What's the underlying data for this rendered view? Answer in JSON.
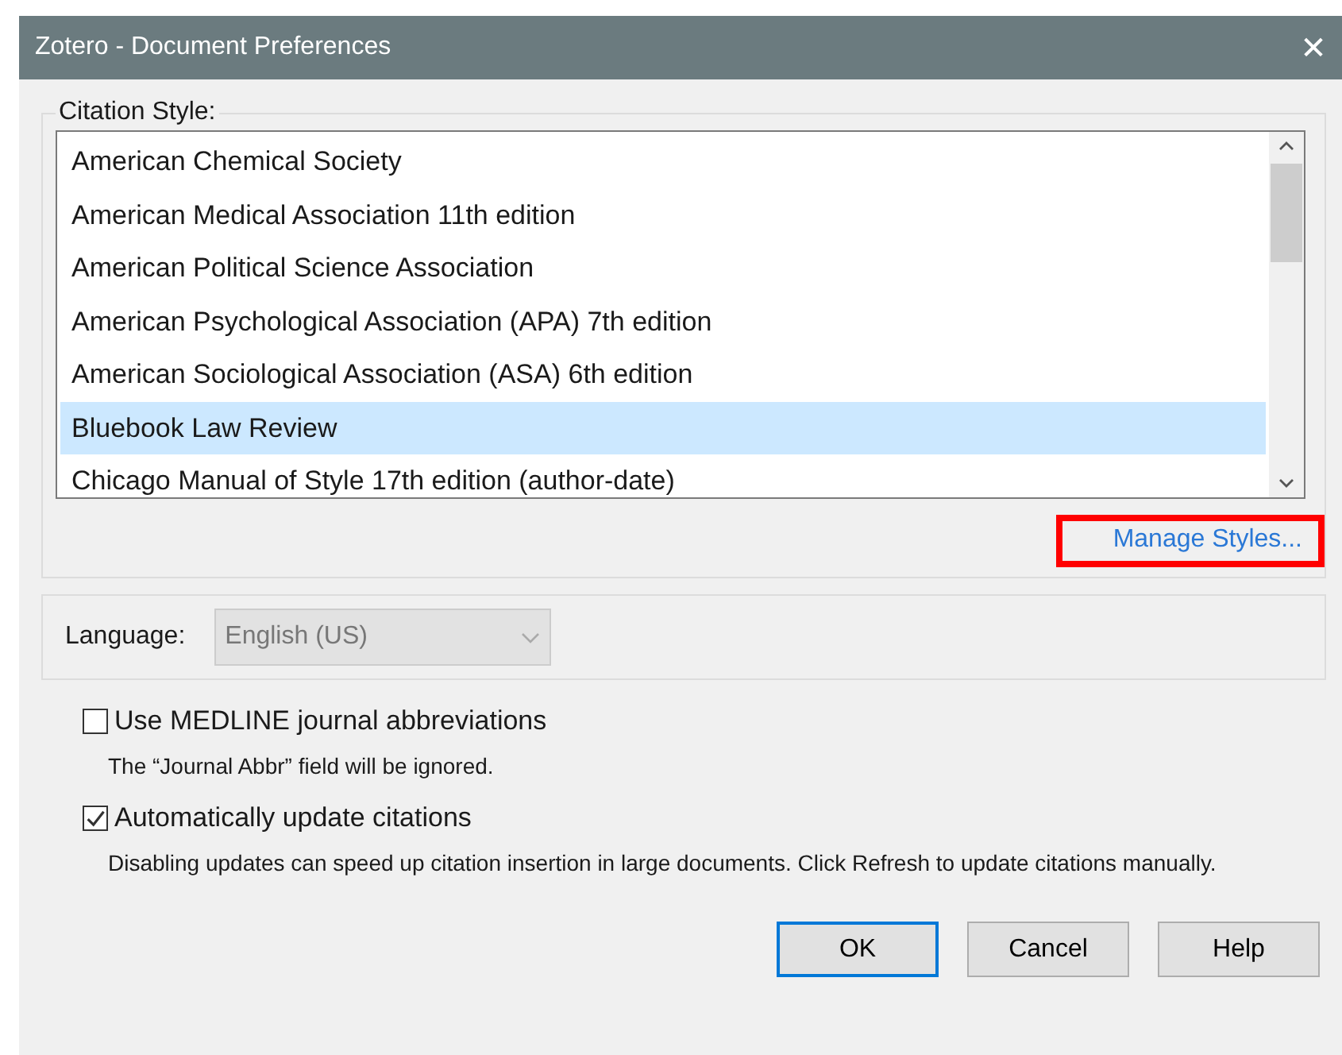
{
  "window": {
    "title": "Zotero - Document Preferences",
    "close": "✕"
  },
  "citation_style": {
    "label": "Citation Style:",
    "styles": [
      {
        "name": "American Chemical Society",
        "selected": false
      },
      {
        "name": "American Medical Association 11th edition",
        "selected": false
      },
      {
        "name": "American Political Science Association",
        "selected": false
      },
      {
        "name": "American Psychological Association (APA) 7th edition",
        "selected": false
      },
      {
        "name": "American Sociological Association (ASA) 6th edition",
        "selected": false
      },
      {
        "name": "Bluebook Law Review",
        "selected": true
      },
      {
        "name": "Chicago Manual of Style 17th edition (author-date)",
        "selected": false
      }
    ],
    "manage_link": {
      "label": "Manage Styles...",
      "highlighted": true
    }
  },
  "language": {
    "label": "Language:",
    "value": "English (US)",
    "disabled": true
  },
  "options": [
    {
      "label": "Use MEDLINE journal abbreviations",
      "checked": false,
      "description": "The “Journal Abbr” field will be ignored."
    },
    {
      "label": "Automatically update citations",
      "checked": true,
      "description": "Disabling updates can speed up citation insertion in large documents. Click Refresh to update citations manually."
    }
  ],
  "buttons": [
    {
      "label": "OK",
      "default": true
    },
    {
      "label": "Cancel",
      "default": false
    },
    {
      "label": "Help",
      "default": false
    }
  ]
}
